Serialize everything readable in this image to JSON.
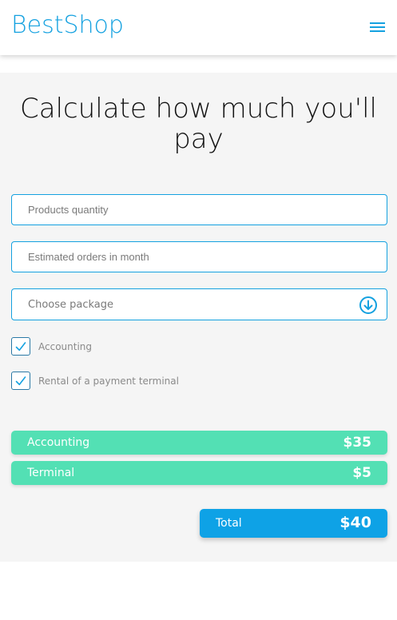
{
  "header": {
    "logo": "BestShop",
    "menu_icon": "hamburger-menu-icon"
  },
  "calculator": {
    "title": "Calculate how much you'll pay",
    "products_quantity": {
      "value": "",
      "placeholder": "Products quantity"
    },
    "estimated_orders": {
      "value": "",
      "placeholder": "Estimated orders in month"
    },
    "package": {
      "label": "Choose package",
      "icon": "arrow-down-circle-icon"
    },
    "checkboxes": [
      {
        "label": "Accounting",
        "checked": true,
        "icon": "checkmark-icon"
      },
      {
        "label": "Rental of a payment terminal",
        "checked": true,
        "icon": "checkmark-icon"
      }
    ]
  },
  "summary": {
    "items": [
      {
        "name": "Accounting",
        "price": "$35"
      },
      {
        "name": "Terminal",
        "price": "$5"
      }
    ],
    "total": {
      "label": "Total",
      "price": "$40"
    }
  },
  "colors": {
    "brand": "#14a1e0",
    "item_background": "#53e0b4",
    "total_background": "#0ea2e6",
    "section_background": "#f5f5f5"
  }
}
